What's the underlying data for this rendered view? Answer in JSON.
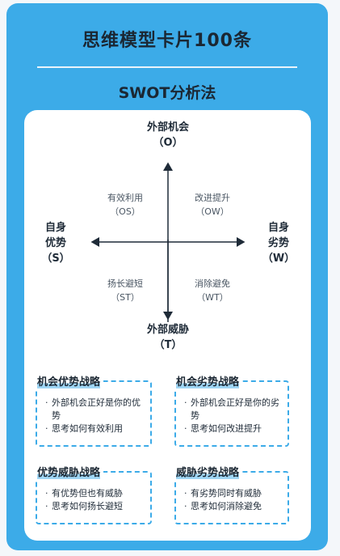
{
  "title": "思维模型卡片100条",
  "subtitle": "SWOT分析法",
  "axes": {
    "top": {
      "line1": "外部机会",
      "line2": "（O）"
    },
    "bottom": {
      "line1": "外部威胁",
      "line2": "（T）"
    },
    "left": {
      "line1": "自身",
      "line2": "优势",
      "line3": "（S）"
    },
    "right": {
      "line1": "自身",
      "line2": "劣势",
      "line3": "（W）"
    }
  },
  "quadrants": {
    "os": {
      "label": "有效利用",
      "code": "（OS）"
    },
    "ow": {
      "label": "改进提升",
      "code": "（OW）"
    },
    "st": {
      "label": "扬长避短",
      "code": "（ST）"
    },
    "wt": {
      "label": "消除避免",
      "code": "（WT）"
    }
  },
  "strategies": [
    {
      "title": "机会优势战略",
      "items": [
        "外部机会正好是你的优势",
        "思考如何有效利用"
      ]
    },
    {
      "title": "机会劣势战略",
      "items": [
        "外部机会正好是你的劣势",
        "思考如何改进提升"
      ]
    },
    {
      "title": "优势威胁战略",
      "items": [
        "有优势但也有威胁",
        "思考如何扬长避短"
      ]
    },
    {
      "title": "威胁劣势战略",
      "items": [
        "有劣势同时有威胁",
        "思考如何消除避免"
      ]
    }
  ],
  "colors": {
    "accent": "#3cabe8",
    "panel": "#ffffff",
    "text": "#1b2733"
  }
}
